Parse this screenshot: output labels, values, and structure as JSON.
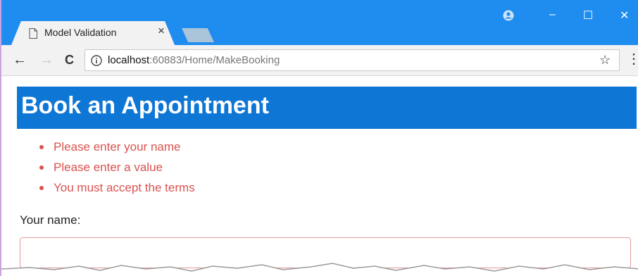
{
  "browser": {
    "tab_title": "Model Validation",
    "tab_close": "×",
    "url_host": "localhost",
    "url_rest": ":60883/Home/MakeBooking",
    "back": "←",
    "forward": "→",
    "reload": "C",
    "bookmark": "☆",
    "menu": "⋮",
    "minimize": "–",
    "maximize": "☐",
    "close": "✕"
  },
  "page": {
    "title": "Book an Appointment",
    "errors": [
      "Please enter your name",
      "Please enter a value",
      "You must accept the terms"
    ],
    "name_label": "Your name:",
    "name_value": ""
  },
  "colors": {
    "titlebar": "#1f8cf0",
    "header": "#0e76d4",
    "error": "#d9534f"
  }
}
